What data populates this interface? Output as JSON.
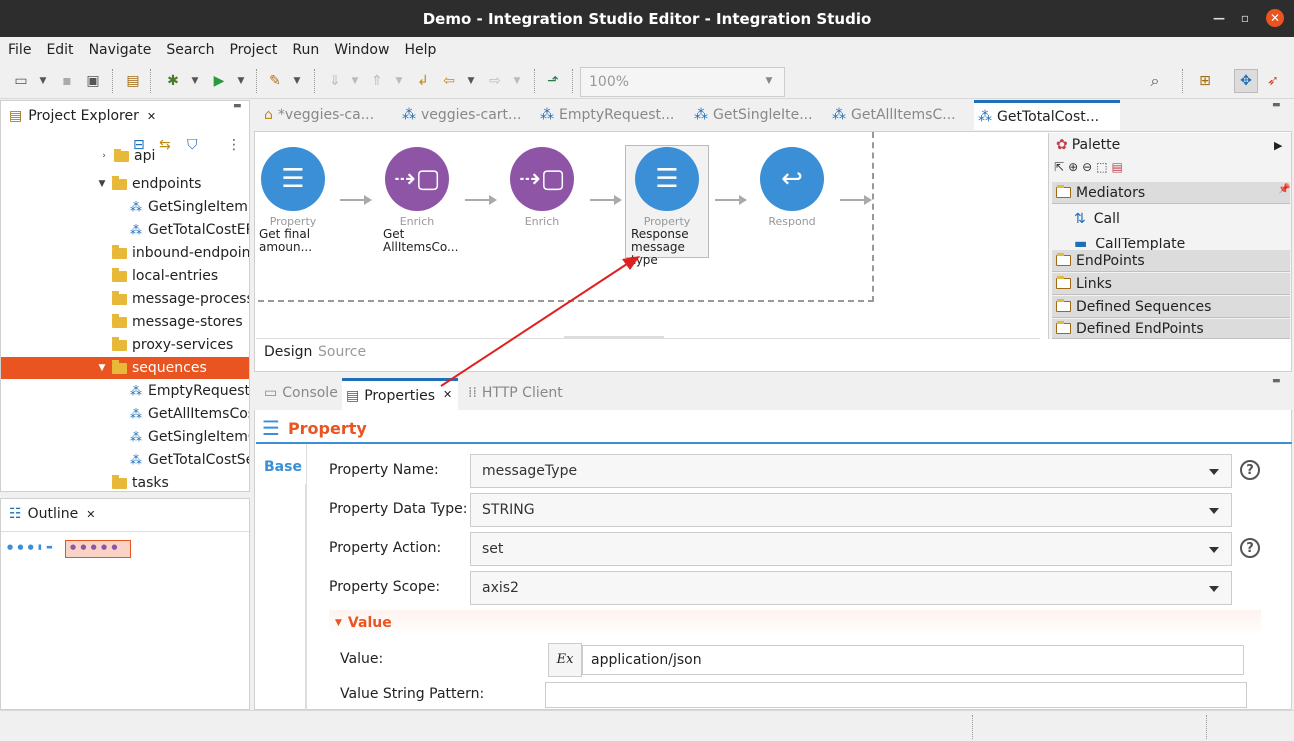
{
  "window": {
    "title": "Demo - Integration Studio Editor - Integration Studio"
  },
  "menu": [
    "File",
    "Edit",
    "Navigate",
    "Search",
    "Project",
    "Run",
    "Window",
    "Help"
  ],
  "toolbar": {
    "zoom": "100%"
  },
  "project_explorer": {
    "title": "Project Explorer",
    "items": [
      {
        "label": "api",
        "type": "folder"
      },
      {
        "label": "endpoints",
        "type": "folder"
      },
      {
        "label": "GetSingleItemE",
        "type": "sequence"
      },
      {
        "label": "GetTotalCostEP",
        "type": "sequence"
      },
      {
        "label": "inbound-endpoints",
        "type": "folder"
      },
      {
        "label": "local-entries",
        "type": "folder"
      },
      {
        "label": "message-processors",
        "type": "folder"
      },
      {
        "label": "message-stores",
        "type": "folder"
      },
      {
        "label": "proxy-services",
        "type": "folder"
      },
      {
        "label": "sequences",
        "type": "folder",
        "selected": true
      },
      {
        "label": "EmptyRequestS",
        "type": "sequence"
      },
      {
        "label": "GetAllItemsCos",
        "type": "sequence"
      },
      {
        "label": "GetSingleItemC",
        "type": "sequence"
      },
      {
        "label": "GetTotalCostSe",
        "type": "sequence"
      },
      {
        "label": "tasks",
        "type": "folder"
      }
    ]
  },
  "outline": {
    "title": "Outline"
  },
  "editor_tabs": [
    "*veggies-ca...",
    "veggies-cart...",
    "EmptyRequest...",
    "GetSingleIte...",
    "GetAllItemsC...",
    "GetTotalCost..."
  ],
  "canvas": {
    "nodes": [
      {
        "type": "Property",
        "desc1": "Get final",
        "desc2": "amoun...",
        "color": "#3a8fd6"
      },
      {
        "type": "Enrich",
        "desc1": "Get",
        "desc2": "AllItemsCo...",
        "color": "#8e55a6"
      },
      {
        "type": "Enrich",
        "desc1": "",
        "desc2": "",
        "color": "#8e55a6"
      },
      {
        "type": "Property",
        "desc1": "Response",
        "desc2": "message type",
        "color": "#3a8fd6"
      },
      {
        "type": "Respond",
        "desc1": "",
        "desc2": "",
        "color": "#3a8fd6"
      }
    ]
  },
  "palette": {
    "title": "Palette",
    "mediators": "Mediators",
    "call": "Call",
    "call_template": "CallTemplate",
    "endpoints": "EndPoints",
    "links": "Links",
    "defined_sequences": "Defined Sequences",
    "defined_endpoints": "Defined EndPoints"
  },
  "editor_mode_tabs": {
    "design": "Design",
    "source": "Source"
  },
  "bottom_tabs": {
    "console": "Console",
    "properties": "Properties",
    "http_client": "HTTP Client"
  },
  "properties": {
    "heading": "Property",
    "side_tab": "Base",
    "name_label": "Property Name:",
    "name_value": "messageType",
    "datatype_label": "Property Data Type:",
    "datatype_value": "STRING",
    "action_label": "Property Action:",
    "action_value": "set",
    "scope_label": "Property Scope:",
    "scope_value": "axis2",
    "value_section": "Value",
    "value_label": "Value:",
    "value_value": "application/json",
    "expr_button": "Ex",
    "pattern_label": "Value String Pattern:",
    "pattern_value": ""
  },
  "colors": {
    "accent": "#e95420",
    "selected_row": "#e95420",
    "property_blue": "#3a8fd6",
    "enrich_purple": "#8e55a6",
    "arrow_red": "#e02020"
  }
}
